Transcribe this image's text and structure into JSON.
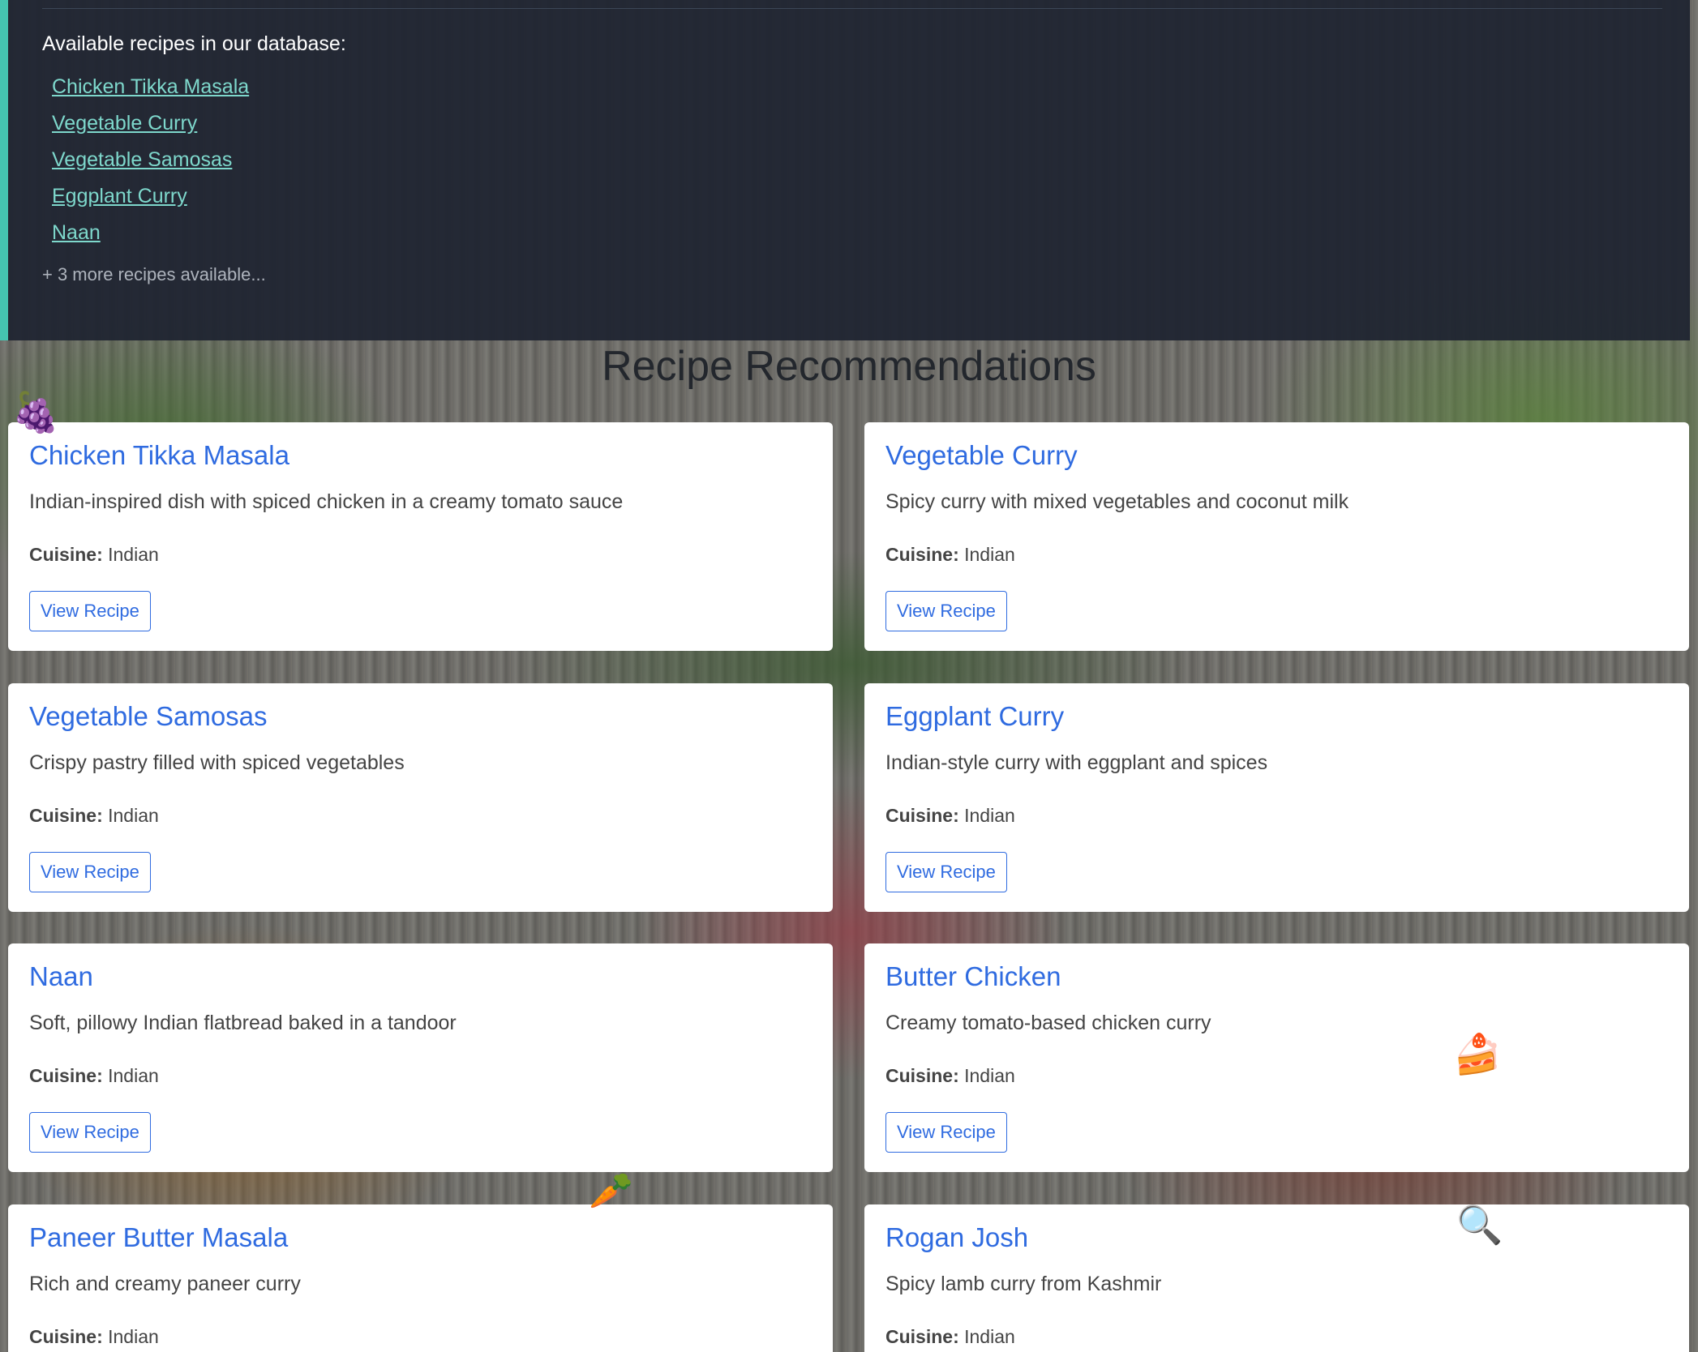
{
  "database": {
    "heading": "Available recipes in our database:",
    "links": [
      "Chicken Tikka Masala",
      "Vegetable Curry",
      "Vegetable Samosas",
      "Eggplant Curry",
      "Naan"
    ],
    "more_text": "+ 3 more recipes available..."
  },
  "recommendations": {
    "title": "Recipe Recommendations",
    "cuisine_label": "Cuisine:",
    "button_label": "View Recipe",
    "cards": [
      {
        "title": "Chicken Tikka Masala",
        "description": "Indian-inspired dish with spiced chicken in a creamy tomato sauce",
        "cuisine": "Indian"
      },
      {
        "title": "Vegetable Curry",
        "description": "Spicy curry with mixed vegetables and coconut milk",
        "cuisine": "Indian"
      },
      {
        "title": "Vegetable Samosas",
        "description": "Crispy pastry filled with spiced vegetables",
        "cuisine": "Indian"
      },
      {
        "title": "Eggplant Curry",
        "description": "Indian-style curry with eggplant and spices",
        "cuisine": "Indian"
      },
      {
        "title": "Naan",
        "description": "Soft, pillowy Indian flatbread baked in a tandoor",
        "cuisine": "Indian"
      },
      {
        "title": "Butter Chicken",
        "description": "Creamy tomato-based chicken curry",
        "cuisine": "Indian"
      },
      {
        "title": "Paneer Butter Masala",
        "description": "Rich and creamy paneer curry",
        "cuisine": "Indian"
      },
      {
        "title": "Rogan Josh",
        "description": "Spicy lamb curry from Kashmir",
        "cuisine": "Indian"
      }
    ]
  },
  "decorations": {
    "grapes_icon": "🍇",
    "cake_icon": "🍰",
    "carrot_icon": "🥕",
    "magnifier_icon": "🔍"
  }
}
